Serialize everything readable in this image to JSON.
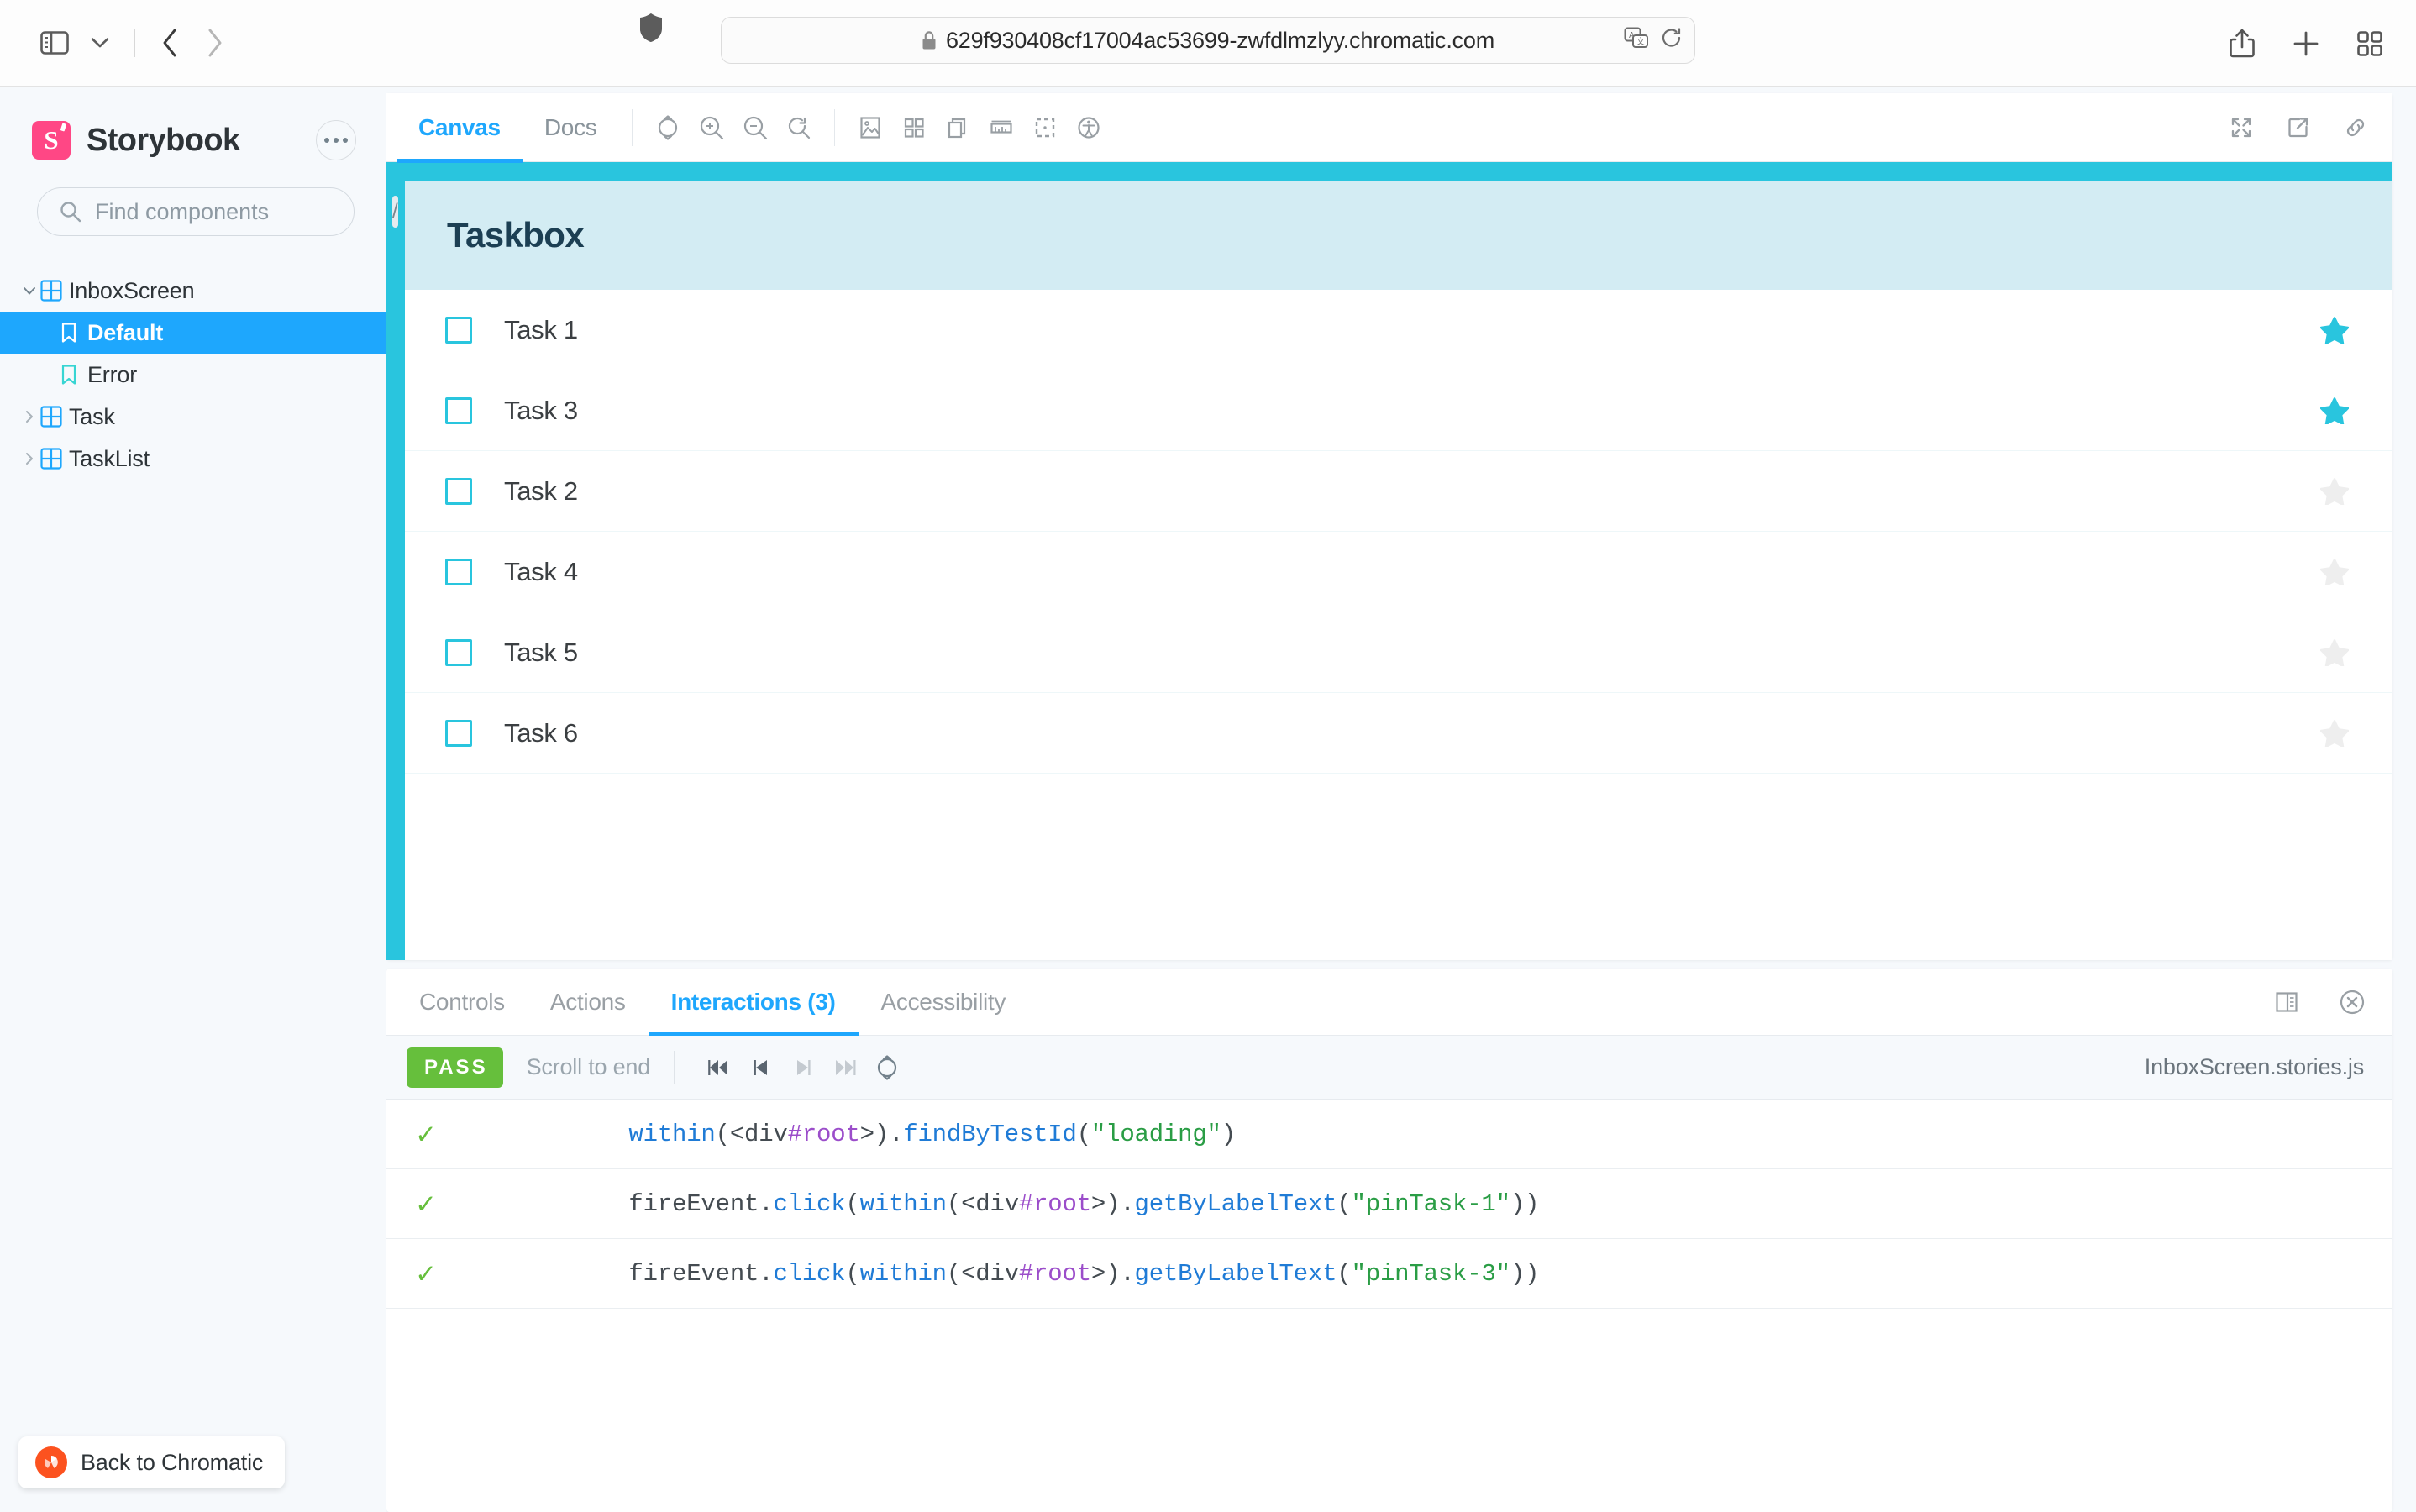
{
  "browser": {
    "url": "629f930408cf17004ac53699-zwfdlmzlyy.chromatic.com",
    "sidebar_toggle_icon": "sidebar-toggle-icon",
    "tab_overview_icon": "chevron-down-icon",
    "back_icon": "chevron-left-icon",
    "forward_icon": "chevron-right-icon",
    "shield_icon": "shield-icon",
    "lock_icon": "lock-icon",
    "translate_icon": "translate-icon",
    "reload_icon": "reload-icon",
    "share_icon": "share-icon",
    "new_tab_icon": "plus-icon",
    "tab_grid_icon": "tab-overview-icon"
  },
  "sidebar": {
    "brand": "Storybook",
    "logo_letter": "S",
    "menu_icon": "ellipsis-icon",
    "search": {
      "placeholder": "Find components",
      "value": "",
      "shortcut": "/",
      "icon": "search-icon"
    },
    "tree": [
      {
        "label": "InboxScreen",
        "type": "component",
        "depth": 0,
        "expanded": true,
        "selected": false,
        "caret": "▼"
      },
      {
        "label": "Default",
        "type": "story",
        "depth": 1,
        "expanded": false,
        "selected": true,
        "caret": ""
      },
      {
        "label": "Error",
        "type": "story",
        "depth": 1,
        "expanded": false,
        "selected": false,
        "caret": ""
      },
      {
        "label": "Task",
        "type": "component",
        "depth": 0,
        "expanded": false,
        "selected": false,
        "caret": "▶"
      },
      {
        "label": "TaskList",
        "type": "component",
        "depth": 0,
        "expanded": false,
        "selected": false,
        "caret": "▶"
      }
    ],
    "chromatic_button": "Back to Chromatic"
  },
  "toolbar": {
    "tabs": [
      {
        "label": "Canvas",
        "active": true
      },
      {
        "label": "Docs",
        "active": false
      }
    ],
    "icons": [
      "remount-icon",
      "zoom-in-icon",
      "zoom-out-icon",
      "zoom-reset-icon",
      "backgrounds-icon",
      "grid-icon",
      "viewport-icon",
      "measure-icon",
      "outline-icon",
      "accessibility-icon"
    ],
    "right_icons": [
      "fullscreen-icon",
      "open-in-new-tab-icon",
      "copy-link-icon"
    ]
  },
  "canvas": {
    "taskbox_title": "Taskbox",
    "tasks": [
      {
        "title": "Task 1",
        "checked": false,
        "pinned": true
      },
      {
        "title": "Task 3",
        "checked": false,
        "pinned": true
      },
      {
        "title": "Task 2",
        "checked": false,
        "pinned": false
      },
      {
        "title": "Task 4",
        "checked": false,
        "pinned": false
      },
      {
        "title": "Task 5",
        "checked": false,
        "pinned": false
      },
      {
        "title": "Task 6",
        "checked": false,
        "pinned": false
      }
    ],
    "accent_color": "#29c5de",
    "header_color": "#d3ecf3",
    "pinned_star_color": "#29c5de",
    "unpinned_star_color": "#eeeeee"
  },
  "panel": {
    "tabs": [
      {
        "label": "Controls",
        "active": false
      },
      {
        "label": "Actions",
        "active": false
      },
      {
        "label": "Interactions (3)",
        "active": true
      },
      {
        "label": "Accessibility",
        "active": false
      }
    ],
    "right_icons": [
      "panel-position-icon",
      "close-panel-icon"
    ],
    "interactions": {
      "status": "PASS",
      "status_color": "#66bf3c",
      "scroll_to_end": "Scroll to end",
      "controls": [
        "rewind-icon",
        "previous-icon",
        "next-icon",
        "end-icon",
        "rerun-icon"
      ],
      "stories_file": "InboxScreen.stories.js",
      "log": [
        {
          "status": "pass",
          "text": "within(<div#root>).findByTestId(\"loading\")",
          "tokens": [
            {
              "t": "within",
              "c": "fn"
            },
            {
              "t": "(",
              "c": "plain"
            },
            {
              "t": "<div",
              "c": "plain"
            },
            {
              "t": "#root",
              "c": "sel"
            },
            {
              "t": ">",
              "c": "plain"
            },
            {
              "t": ").",
              "c": "plain"
            },
            {
              "t": "findByTestId",
              "c": "fn"
            },
            {
              "t": "(",
              "c": "plain"
            },
            {
              "t": "\"loading\"",
              "c": "str"
            },
            {
              "t": ")",
              "c": "plain"
            }
          ]
        },
        {
          "status": "pass",
          "text": "fireEvent.click(within(<div#root>).getByLabelText(\"pinTask-1\"))",
          "tokens": [
            {
              "t": "fireEvent.",
              "c": "plain"
            },
            {
              "t": "click",
              "c": "fn"
            },
            {
              "t": "(",
              "c": "plain"
            },
            {
              "t": "within",
              "c": "fn"
            },
            {
              "t": "(",
              "c": "plain"
            },
            {
              "t": "<div",
              "c": "plain"
            },
            {
              "t": "#root",
              "c": "sel"
            },
            {
              "t": ">",
              "c": "plain"
            },
            {
              "t": ").",
              "c": "plain"
            },
            {
              "t": "getByLabelText",
              "c": "fn"
            },
            {
              "t": "(",
              "c": "plain"
            },
            {
              "t": "\"pinTask-1\"",
              "c": "str"
            },
            {
              "t": "))",
              "c": "plain"
            }
          ]
        },
        {
          "status": "pass",
          "text": "fireEvent.click(within(<div#root>).getByLabelText(\"pinTask-3\"))",
          "tokens": [
            {
              "t": "fireEvent.",
              "c": "plain"
            },
            {
              "t": "click",
              "c": "fn"
            },
            {
              "t": "(",
              "c": "plain"
            },
            {
              "t": "within",
              "c": "fn"
            },
            {
              "t": "(",
              "c": "plain"
            },
            {
              "t": "<div",
              "c": "plain"
            },
            {
              "t": "#root",
              "c": "sel"
            },
            {
              "t": ">",
              "c": "plain"
            },
            {
              "t": ").",
              "c": "plain"
            },
            {
              "t": "getByLabelText",
              "c": "fn"
            },
            {
              "t": "(",
              "c": "plain"
            },
            {
              "t": "\"pinTask-3\"",
              "c": "str"
            },
            {
              "t": "))",
              "c": "plain"
            }
          ]
        }
      ]
    }
  }
}
